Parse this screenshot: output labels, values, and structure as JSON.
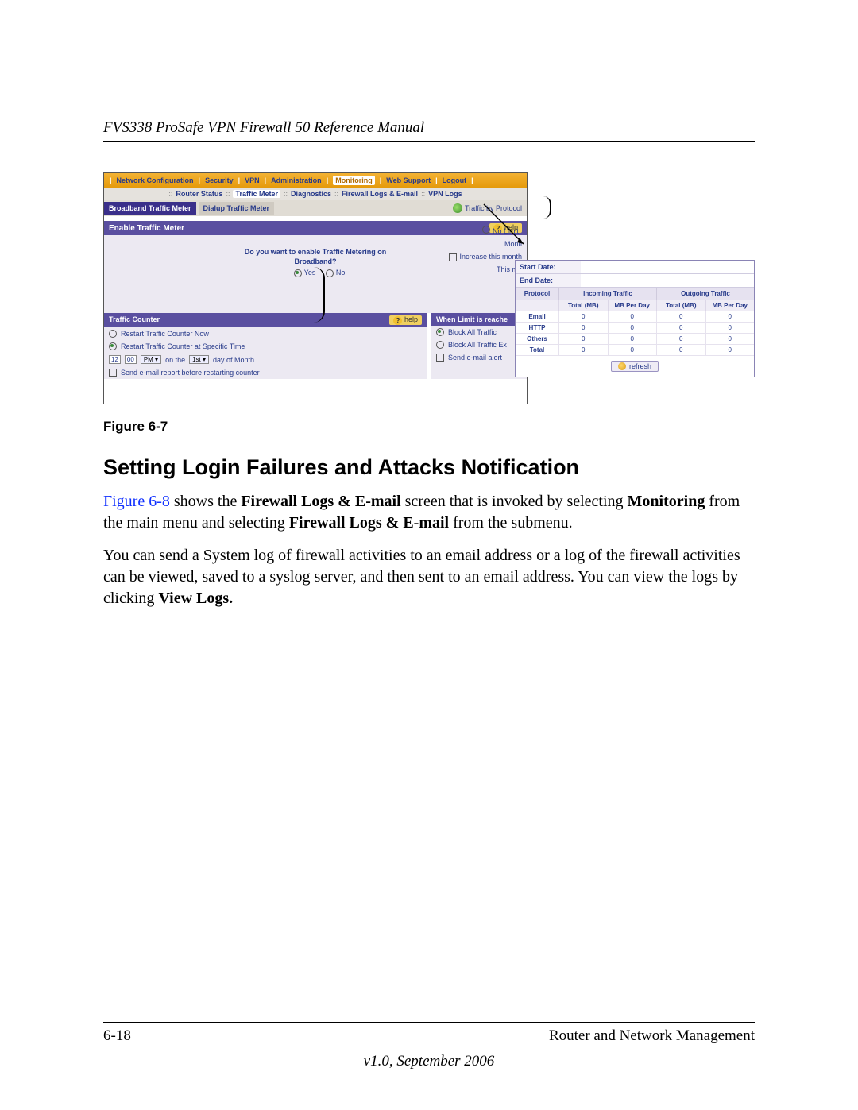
{
  "header_title": "FVS338 ProSafe VPN Firewall 50 Reference Manual",
  "figure_caption": "Figure 6-7",
  "section_heading": "Setting Login Failures and Attacks Notification",
  "para1_a": "Figure 6-8",
  "para1_b": " shows the ",
  "para1_c": "Firewall Logs & E-mail",
  "para1_d": " screen that is invoked by selecting ",
  "para1_e": "Monitoring",
  "para1_f": " from the main menu and selecting ",
  "para1_g": "Firewall Logs & E-mail",
  "para1_h": " from the submenu.",
  "para2": "You can send a System log of firewall activities to an email address or a log of the firewall activities can be viewed, saved to a syslog server, and then sent to an email address. You can view the logs by clicking ",
  "para2_b": "View Logs.",
  "footer_left": "6-18",
  "footer_right": "Router and Network Management",
  "version_line": "v1.0, September 2006",
  "nav": {
    "items": [
      "Network Configuration",
      "Security",
      "VPN",
      "Administration",
      "Monitoring",
      "Web Support",
      "Logout"
    ]
  },
  "subnav": {
    "items": [
      "Router Status",
      "Traffic Meter",
      "Diagnostics",
      "Firewall Logs & E-mail",
      "VPN Logs"
    ]
  },
  "tabs": {
    "active": "Broadband Traffic Meter",
    "inactive": "Dialup Traffic Meter",
    "right_link": "Traffic by Protocol"
  },
  "panel1": {
    "title": "Enable Traffic Meter",
    "help": "help",
    "nolimit": "No Limit",
    "question1": "Do you want to enable Traffic Metering on",
    "question2": "Broadband?",
    "yes": "Yes",
    "no": "No",
    "right1": "Montl",
    "right2_chk": "Increase this month",
    "right3": "This mo"
  },
  "traffic_counter": {
    "title": "Traffic Counter",
    "help": "help",
    "o1": "Restart Traffic Counter Now",
    "o2": "Restart Traffic Counter at Specific Time",
    "time_h": "12",
    "time_m": "00",
    "ampm": "PM",
    "mid1": "on the",
    "daysel": "1st",
    "mid2": "day of Month.",
    "o3": "Send e-mail report before restarting counter"
  },
  "limit_panel": {
    "title": "When Limit is reache",
    "o1": "Block All Traffic",
    "o2": "Block All Traffic Ex",
    "o3": "Send e-mail alert"
  },
  "popup": {
    "start_lab": "Start Date:",
    "end_lab": "End Date:",
    "grp_in": "Incoming Traffic",
    "grp_out": "Outgoing Traffic",
    "col_proto": "Protocol",
    "col_mb": "Total (MB)",
    "col_day": "MB Per Day",
    "rows": [
      {
        "p": "Email",
        "a": "0",
        "b": "0",
        "c": "0",
        "d": "0"
      },
      {
        "p": "HTTP",
        "a": "0",
        "b": "0",
        "c": "0",
        "d": "0"
      },
      {
        "p": "Others",
        "a": "0",
        "b": "0",
        "c": "0",
        "d": "0"
      },
      {
        "p": "Total",
        "a": "0",
        "b": "0",
        "c": "0",
        "d": "0"
      }
    ],
    "refresh": "refresh"
  }
}
